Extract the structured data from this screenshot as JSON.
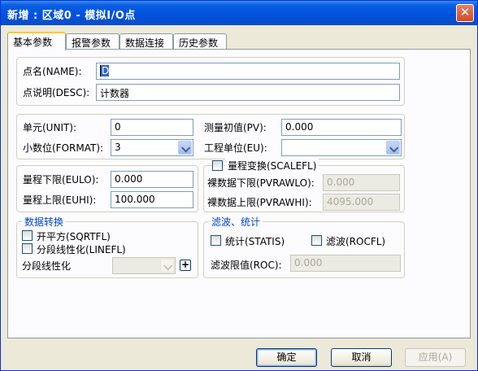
{
  "window": {
    "title": "新增 : 区域0 - 模拟I/O点",
    "close_label": "✕"
  },
  "tabs": [
    {
      "label": "基本参数",
      "active": true
    },
    {
      "label": "报警参数",
      "active": false
    },
    {
      "label": "数据连接",
      "active": false
    },
    {
      "label": "历史参数",
      "active": false
    }
  ],
  "name_group": {
    "name_label": "点名(NAME):",
    "name_value": "D",
    "desc_label": "点说明(DESC):",
    "desc_value": "计数器"
  },
  "unit_group": {
    "unit_label": "单元(UNIT):",
    "unit_value": "0",
    "format_label": "小数位(FORMAT):",
    "format_value": "3",
    "pv_label": "测量初值(PV):",
    "pv_value": "0.000",
    "eu_label": "工程单位(EU):",
    "eu_value": ""
  },
  "range_group": {
    "eulo_label": "量程下限(EULO):",
    "eulo_value": "0.000",
    "euhi_label": "量程上限(EUHI):",
    "euhi_value": "100.000"
  },
  "scale_group": {
    "title": "量程变换(SCALEFL)",
    "checked": false,
    "pvrawlo_label": "裸数据下限(PVRAWLO):",
    "pvrawlo_value": "0.000",
    "pvrawhi_label": "裸数据上限(PVRAWHI):",
    "pvrawhi_value": "4095.000"
  },
  "convert_group": {
    "title": "数据转换",
    "sqrt_label": "开平方(SQRTFL)",
    "sqrt_checked": false,
    "linear_label": "分段线性化(LINEFL)",
    "linear_checked": false,
    "segment_label": "分段线性化",
    "segment_value": "",
    "add_label": "+"
  },
  "filter_group": {
    "title": "滤波、统计",
    "statis_label": "统计(STATIS)",
    "statis_checked": false,
    "rocfl_label": "滤波(ROCFL)",
    "rocfl_checked": false,
    "roc_label": "滤波限值(ROC):",
    "roc_value": "0.000"
  },
  "buttons": {
    "ok": "确定",
    "cancel": "取消",
    "apply": "应用(A)"
  },
  "colors": {
    "titlebar": "#0052df",
    "group_title": "#0046d5",
    "tab_highlight": "#ffc83c"
  }
}
